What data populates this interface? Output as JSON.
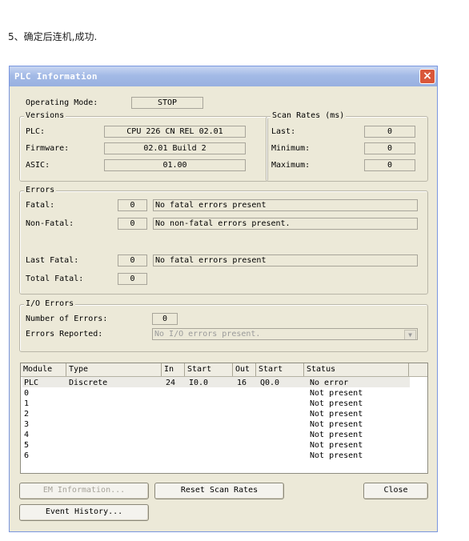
{
  "caption": "5、确定后连机,成功.",
  "window": {
    "title": "PLC Information",
    "close_glyph": "×"
  },
  "operating_mode": {
    "label": "Operating Mode:",
    "value": "STOP"
  },
  "versions": {
    "legend": "Versions",
    "plc_label": "PLC:",
    "plc_value": "CPU 226 CN REL 02.01",
    "firmware_label": "Firmware:",
    "firmware_value": "02.01 Build 2",
    "asic_label": "ASIC:",
    "asic_value": "01.00"
  },
  "scan_rates": {
    "legend": "Scan Rates (ms)",
    "last_label": "Last:",
    "last_value": "0",
    "minimum_label": "Minimum:",
    "minimum_value": "0",
    "maximum_label": "Maximum:",
    "maximum_value": "0"
  },
  "errors": {
    "legend": "Errors",
    "fatal_label": "Fatal:",
    "fatal_count": "0",
    "fatal_msg": "No fatal errors present",
    "nonfatal_label": "Non-Fatal:",
    "nonfatal_count": "0",
    "nonfatal_msg": "No non-fatal errors present.",
    "lastfatal_label": "Last Fatal:",
    "lastfatal_count": "0",
    "lastfatal_msg": "No fatal errors present",
    "totalfatal_label": "Total Fatal:",
    "totalfatal_count": "0"
  },
  "io_errors": {
    "legend": "I/O Errors",
    "number_label": "Number of Errors:",
    "number_value": "0",
    "reported_label": "Errors Reported:",
    "reported_value": "No I/O errors present."
  },
  "modules_table": {
    "headers": [
      "Module",
      "Type",
      "In",
      "Start",
      "Out",
      "Start",
      "Status"
    ],
    "rows": [
      [
        "PLC",
        "Discrete",
        "24",
        "I0.0",
        "16",
        "Q0.0",
        "No error"
      ],
      [
        "0",
        "",
        "",
        "",
        "",
        "",
        "Not present"
      ],
      [
        "1",
        "",
        "",
        "",
        "",
        "",
        "Not present"
      ],
      [
        "2",
        "",
        "",
        "",
        "",
        "",
        "Not present"
      ],
      [
        "3",
        "",
        "",
        "",
        "",
        "",
        "Not present"
      ],
      [
        "4",
        "",
        "",
        "",
        "",
        "",
        "Not present"
      ],
      [
        "5",
        "",
        "",
        "",
        "",
        "",
        "Not present"
      ],
      [
        "6",
        "",
        "",
        "",
        "",
        "",
        "Not present"
      ]
    ]
  },
  "buttons": {
    "em_information": "EM Information...",
    "reset_scan_rates": "Reset Scan Rates",
    "close": "Close",
    "event_history": "Event History..."
  },
  "colors": {
    "title_text": "#ffffff",
    "close_button": "#d9573a",
    "dialog_bg": "#ece9d8"
  }
}
